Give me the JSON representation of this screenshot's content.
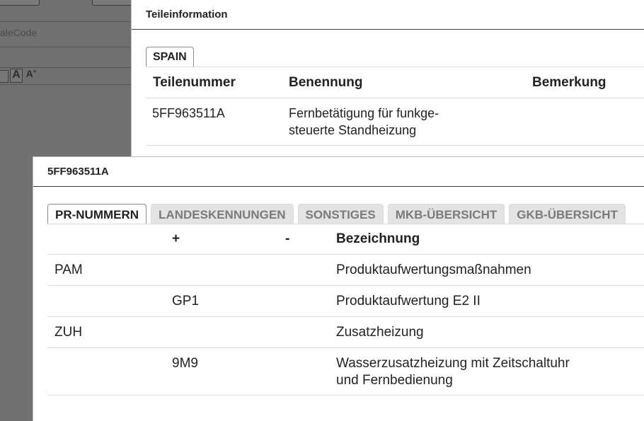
{
  "background": {
    "label_fragment": "aleCode",
    "font_controls": {
      "small": "",
      "medium": "A",
      "large": "A"
    }
  },
  "dialog1": {
    "title": "Teileinformation",
    "tab": "SPAIN",
    "columns": [
      "Teilenummer",
      "Benennung",
      "Bemerkung"
    ],
    "rows": [
      {
        "teilenummer": "5FF963511A",
        "benennung_line1": "Fernbetätigung für funkge-",
        "benennung_line2": "steuerte Standheizung",
        "bemerkung": ""
      }
    ]
  },
  "dialog2": {
    "title": "5FF963511A",
    "tabs": [
      "PR-NUMMERN",
      "LANDESKENNUNGEN",
      "SONSTIGES",
      "MKB-ÜBERSICHT",
      "GKB-ÜBERSICHT"
    ],
    "active_tab": "PR-NUMMERN",
    "columns": {
      "col1": "",
      "plus": "+",
      "minus": "-",
      "bezeichnung": "Bezeichnung"
    },
    "rows": [
      {
        "col1": "PAM",
        "plus": "",
        "minus": "",
        "bezeichnung": "Produktaufwertungsmaßnahmen"
      },
      {
        "col1": "",
        "plus": "GP1",
        "minus": "",
        "bezeichnung": "Produktaufwertung E2 II"
      },
      {
        "col1": "ZUH",
        "plus": "",
        "minus": "",
        "bezeichnung": "Zusatzheizung"
      },
      {
        "col1": "",
        "plus": "9M9",
        "minus": "",
        "bezeichnung_line1": "Wasserzusatzheizung mit Zeitschaltuhr",
        "bezeichnung_line2": "und Fernbedienung"
      }
    ]
  }
}
